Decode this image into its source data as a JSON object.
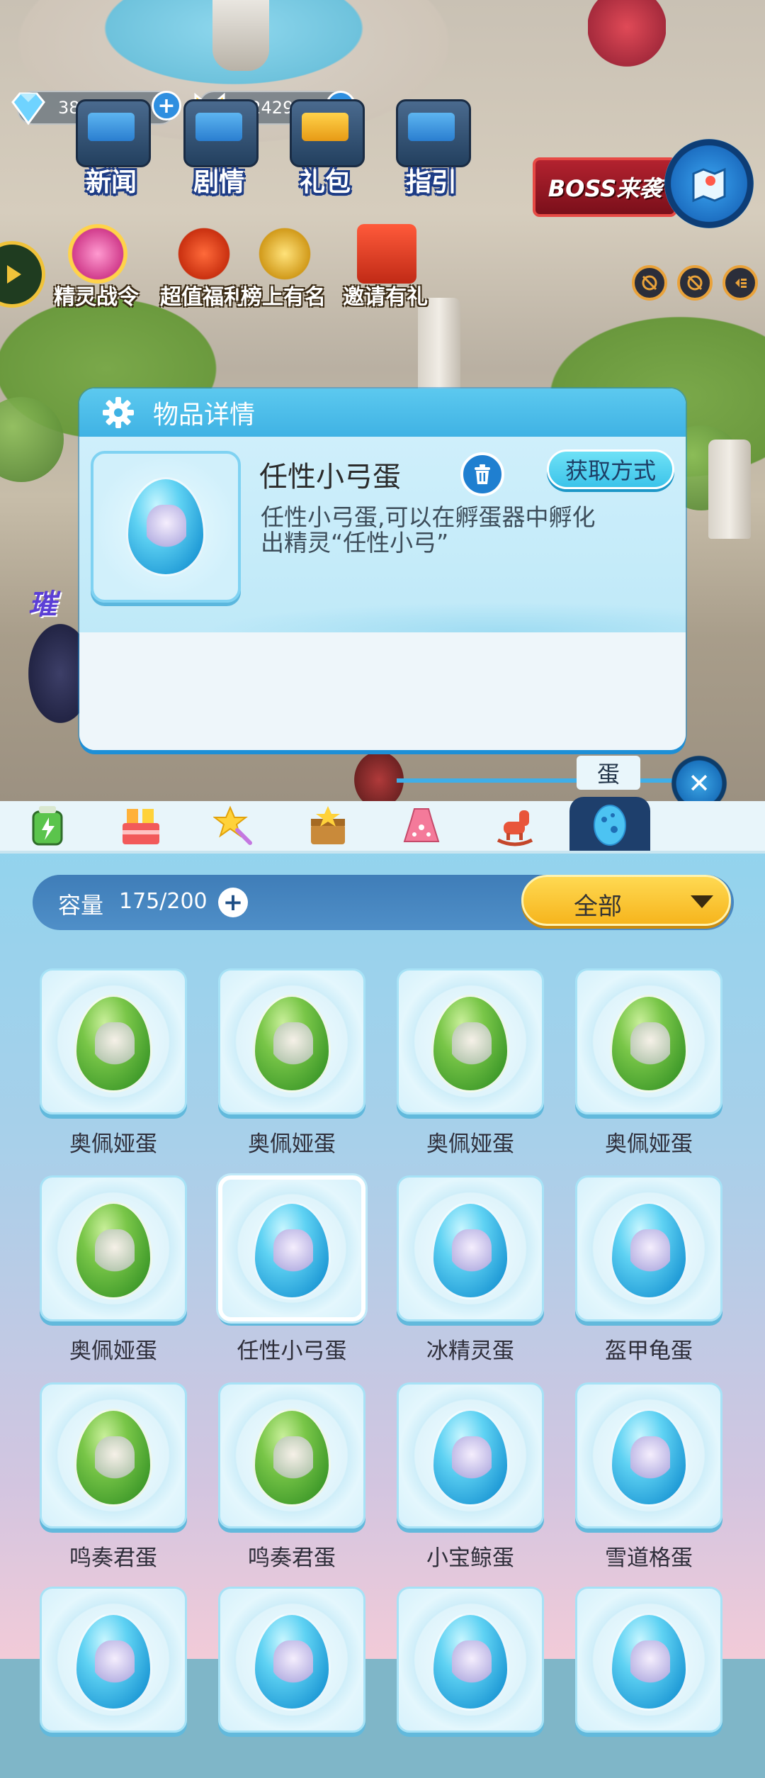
{
  "resources": {
    "diamonds": "381",
    "coins": "124293"
  },
  "top_menu": [
    {
      "label": "新闻",
      "icon": "news-icon"
    },
    {
      "label": "剧情",
      "icon": "story-icon"
    },
    {
      "label": "礼包",
      "icon": "gift-pack-icon"
    },
    {
      "label": "指引",
      "icon": "guide-icon"
    }
  ],
  "events": [
    {
      "label": "精灵战令",
      "icon": "battle-pass-icon"
    },
    {
      "label": "超值福利",
      "icon": "welfare-icon"
    },
    {
      "label": "榜上有名",
      "icon": "trophy-icon"
    },
    {
      "label": "邀请有礼",
      "icon": "invite-icon"
    }
  ],
  "boss_banner": "BOSS来袭",
  "detail": {
    "title": "物品详情",
    "item_name": "任性小弓蛋",
    "obtain_button": "获取方式",
    "description_line1": "任性小弓蛋,可以在孵蛋器中孵化",
    "description_line2": "出精灵“任性小弓”"
  },
  "bag": {
    "active_tab_tip": "蛋",
    "tabs": [
      "battery-icon",
      "gift-box-icon",
      "star-wand-icon",
      "star-chest-icon",
      "dress-icon",
      "rocking-horse-icon",
      "egg-icon"
    ],
    "capacity_label": "容量",
    "capacity_value": "175/200",
    "filter_label": "全部",
    "items": [
      {
        "label": "奥佩娅蛋",
        "color": "green"
      },
      {
        "label": "奥佩娅蛋",
        "color": "green"
      },
      {
        "label": "奥佩娅蛋",
        "color": "green"
      },
      {
        "label": "奥佩娅蛋",
        "color": "green"
      },
      {
        "label": "奥佩娅蛋",
        "color": "green"
      },
      {
        "label": "任性小弓蛋",
        "color": "blue"
      },
      {
        "label": "冰精灵蛋",
        "color": "blue"
      },
      {
        "label": "盔甲龟蛋",
        "color": "blue"
      },
      {
        "label": "鸣奏君蛋",
        "color": "green"
      },
      {
        "label": "鸣奏君蛋",
        "color": "green"
      },
      {
        "label": "小宝鲸蛋",
        "color": "blue"
      },
      {
        "label": "雪道格蛋",
        "color": "blue"
      }
    ]
  }
}
